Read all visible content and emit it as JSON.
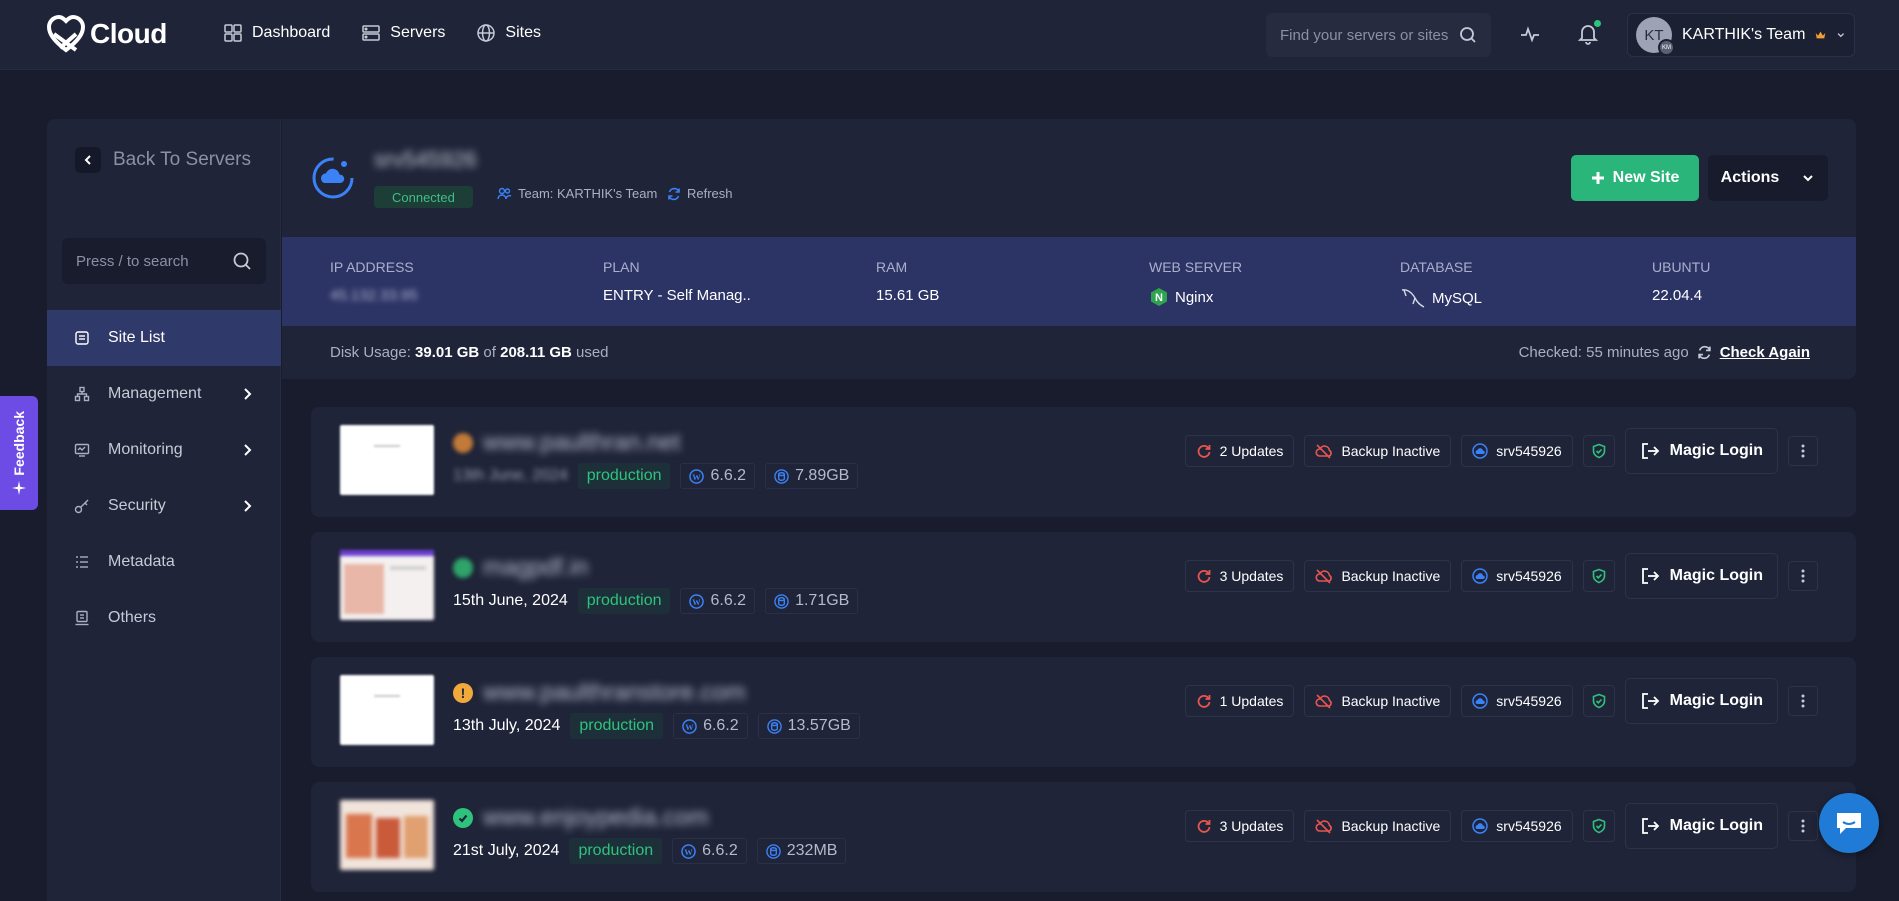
{
  "brand": {
    "name": "Cloud"
  },
  "nav": [
    {
      "label": "Dashboard",
      "icon": "grid-icon"
    },
    {
      "label": "Servers",
      "icon": "server-icon"
    },
    {
      "label": "Sites",
      "icon": "globe-icon"
    }
  ],
  "search_top": {
    "placeholder": "Find your servers or sites"
  },
  "team": {
    "initials": "KT",
    "sub_initials": "KM",
    "name": "KARTHIK's Team",
    "crown_color": "#f0a030"
  },
  "sidebar": {
    "back_label": "Back To Servers",
    "search_placeholder": "Press / to search",
    "items": [
      {
        "label": "Site List",
        "active": true
      },
      {
        "label": "Management",
        "expandable": true
      },
      {
        "label": "Monitoring",
        "expandable": true
      },
      {
        "label": "Security",
        "expandable": true
      },
      {
        "label": "Metadata"
      },
      {
        "label": "Others"
      }
    ]
  },
  "feedback": {
    "label": "Feedback"
  },
  "server": {
    "name": "srv545926",
    "status": "Connected",
    "team_label": "Team: KARTHIK's Team",
    "refresh_label": "Refresh",
    "new_site_label": "New Site",
    "actions_label": "Actions",
    "stats": {
      "ip": {
        "label": "IP ADDRESS",
        "value": "45.132.33.95"
      },
      "plan": {
        "label": "PLAN",
        "value": "ENTRY - Self Manag.."
      },
      "ram": {
        "label": "RAM",
        "value": "15.61 GB"
      },
      "web_server": {
        "label": "WEB SERVER",
        "value": "Nginx"
      },
      "database": {
        "label": "DATABASE",
        "value": "MySQL"
      },
      "os": {
        "label": "UBUNTU",
        "value": "22.04.4"
      }
    },
    "disk": {
      "prefix": "Disk Usage:",
      "used": "39.01 GB",
      "of": "of",
      "total": "208.11 GB",
      "suffix": "used"
    },
    "checked": {
      "label": "Checked: 55 minutes ago",
      "action": "Check Again"
    }
  },
  "sites": [
    {
      "domain": "www.paulthran.net",
      "status": "warning-orange",
      "date": "13th June, 2024",
      "env": "production",
      "wp_version": "6.6.2",
      "size": "7.89GB",
      "updates": "2 Updates",
      "backup": "Backup Inactive",
      "server": "srv545926",
      "login": "Magic Login"
    },
    {
      "domain": "magpdf.in",
      "status": "ok-green",
      "date": "15th June, 2024",
      "env": "production",
      "wp_version": "6.6.2",
      "size": "1.71GB",
      "updates": "3 Updates",
      "backup": "Backup Inactive",
      "server": "srv545926",
      "login": "Magic Login"
    },
    {
      "domain": "www.paulthranstore.com",
      "status": "warning",
      "date": "13th July, 2024",
      "env": "production",
      "wp_version": "6.6.2",
      "size": "13.57GB",
      "updates": "1 Updates",
      "backup": "Backup Inactive",
      "server": "srv545926",
      "login": "Magic Login"
    },
    {
      "domain": "www.enjoypedia.com",
      "status": "ok",
      "date": "21st July, 2024",
      "env": "production",
      "wp_version": "6.6.2",
      "size": "232MB",
      "updates": "3 Updates",
      "backup": "Backup Inactive",
      "server": "srv545926",
      "login": "Magic Login"
    }
  ]
}
